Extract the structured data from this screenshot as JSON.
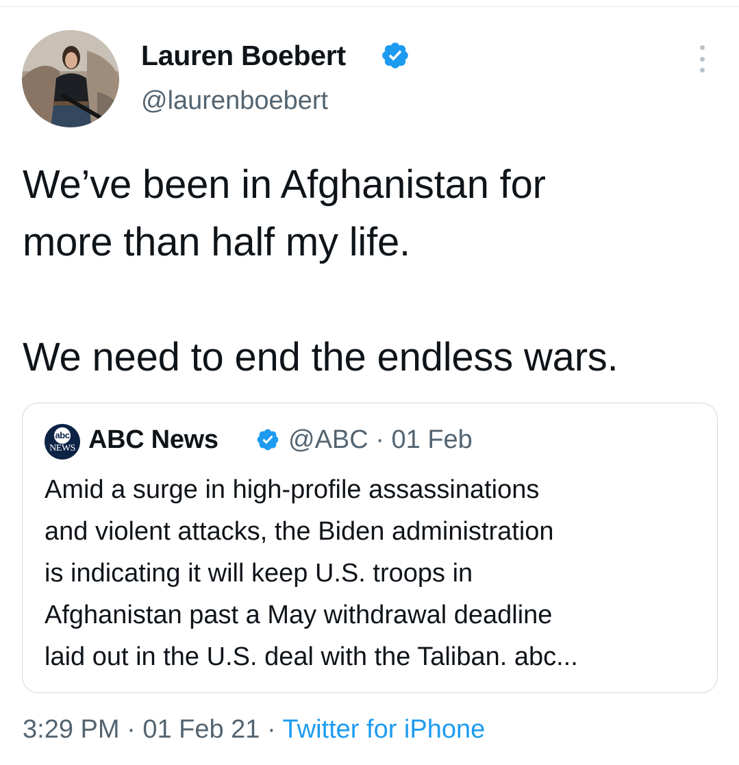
{
  "tweet": {
    "author": {
      "display_name": "Lauren Boebert",
      "handle": "@laurenboebert",
      "verified": true
    },
    "text_lines": [
      "We’ve been in Afghanistan for",
      "more than half my life.",
      "We need to end the endless wars."
    ],
    "time": "3:29 PM",
    "date": "01 Feb 21",
    "source": "Twitter for iPhone",
    "separator": "·"
  },
  "quoted_tweet": {
    "avatar_logo": "abc",
    "avatar_sub": "NEWS",
    "display_name": "ABC News",
    "handle": "@ABC",
    "separator": "·",
    "date": "01 Feb",
    "verified": true,
    "text_lines": [
      "Amid a surge in high-profile assassinations",
      "and violent attacks, the Biden administration",
      "is indicating it will keep U.S. troops in",
      "Afghanistan past a May withdrawal deadline",
      "laid out in the U.S. deal with the Taliban. abc..."
    ]
  },
  "icons": {
    "verified": "verified-badge-icon",
    "more": "more-options-icon"
  },
  "colors": {
    "text": "#0f1419",
    "secondary": "#536471",
    "link": "#1d9bf0",
    "verified": "#1d9bf0",
    "border": "#cfd9de"
  }
}
